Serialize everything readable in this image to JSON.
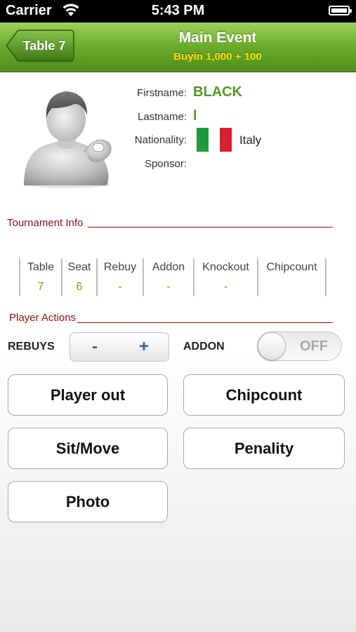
{
  "status_bar": {
    "carrier": "Carrier",
    "time": "5:43 PM"
  },
  "nav": {
    "back_label": "Table 7",
    "title": "Main Event",
    "subtitle": "Buyin 1,000 + 100"
  },
  "player": {
    "firstname_label": "Firstname:",
    "firstname": "BLACK",
    "lastname_label": "Lastname:",
    "lastname": "l",
    "nationality_label": "Nationality:",
    "nationality": "Italy",
    "sponsor_label": "Sponsor:",
    "sponsor": ""
  },
  "tournament_info": {
    "title": "Tournament Info",
    "columns": [
      {
        "header": "Table",
        "value": "7"
      },
      {
        "header": "Seat",
        "value": "6"
      },
      {
        "header": "Rebuy",
        "value": "-"
      },
      {
        "header": "Addon",
        "value": "-"
      },
      {
        "header": "Knockout",
        "value": "-"
      },
      {
        "header": "Chipcount",
        "value": ""
      }
    ]
  },
  "player_actions": {
    "title": "Player Actions",
    "rebuys_label": "REBUYS",
    "stepper_minus": "-",
    "stepper_plus": "+",
    "addon_label": "ADDON",
    "addon_toggle": "OFF"
  },
  "buttons": {
    "player_out": "Player out",
    "chipcount": "Chipcount",
    "sit_move": "Sit/Move",
    "penality": "Penality",
    "photo": "Photo"
  },
  "colors": {
    "accent_green": "#6eae2d",
    "value_green": "#4f9a24",
    "section_red": "#8b1010",
    "value_orange": "#c07b00"
  }
}
